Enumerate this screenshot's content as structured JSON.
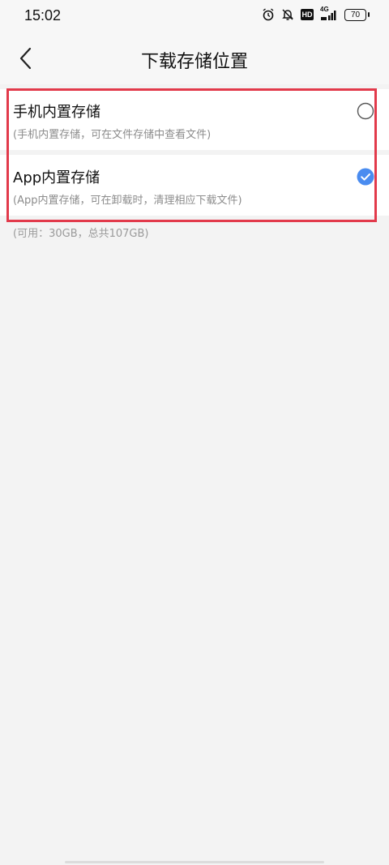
{
  "status_bar": {
    "time": "15:02",
    "hd_label": "HD",
    "network_label": "4G",
    "battery_level": "70"
  },
  "header": {
    "title": "下载存储位置"
  },
  "options": [
    {
      "title": "手机内置存储",
      "description": "(手机内置存储，可在文件存储中查看文件)",
      "selected": false
    },
    {
      "title": "App内置存储",
      "description": "(App内置存储，可在卸载时，清理相应下载文件)",
      "selected": true
    }
  ],
  "storage_info": "(可用：30GB，总共107GB)",
  "colors": {
    "accent": "#4a8cf0",
    "highlight_frame": "#e23a4b"
  }
}
